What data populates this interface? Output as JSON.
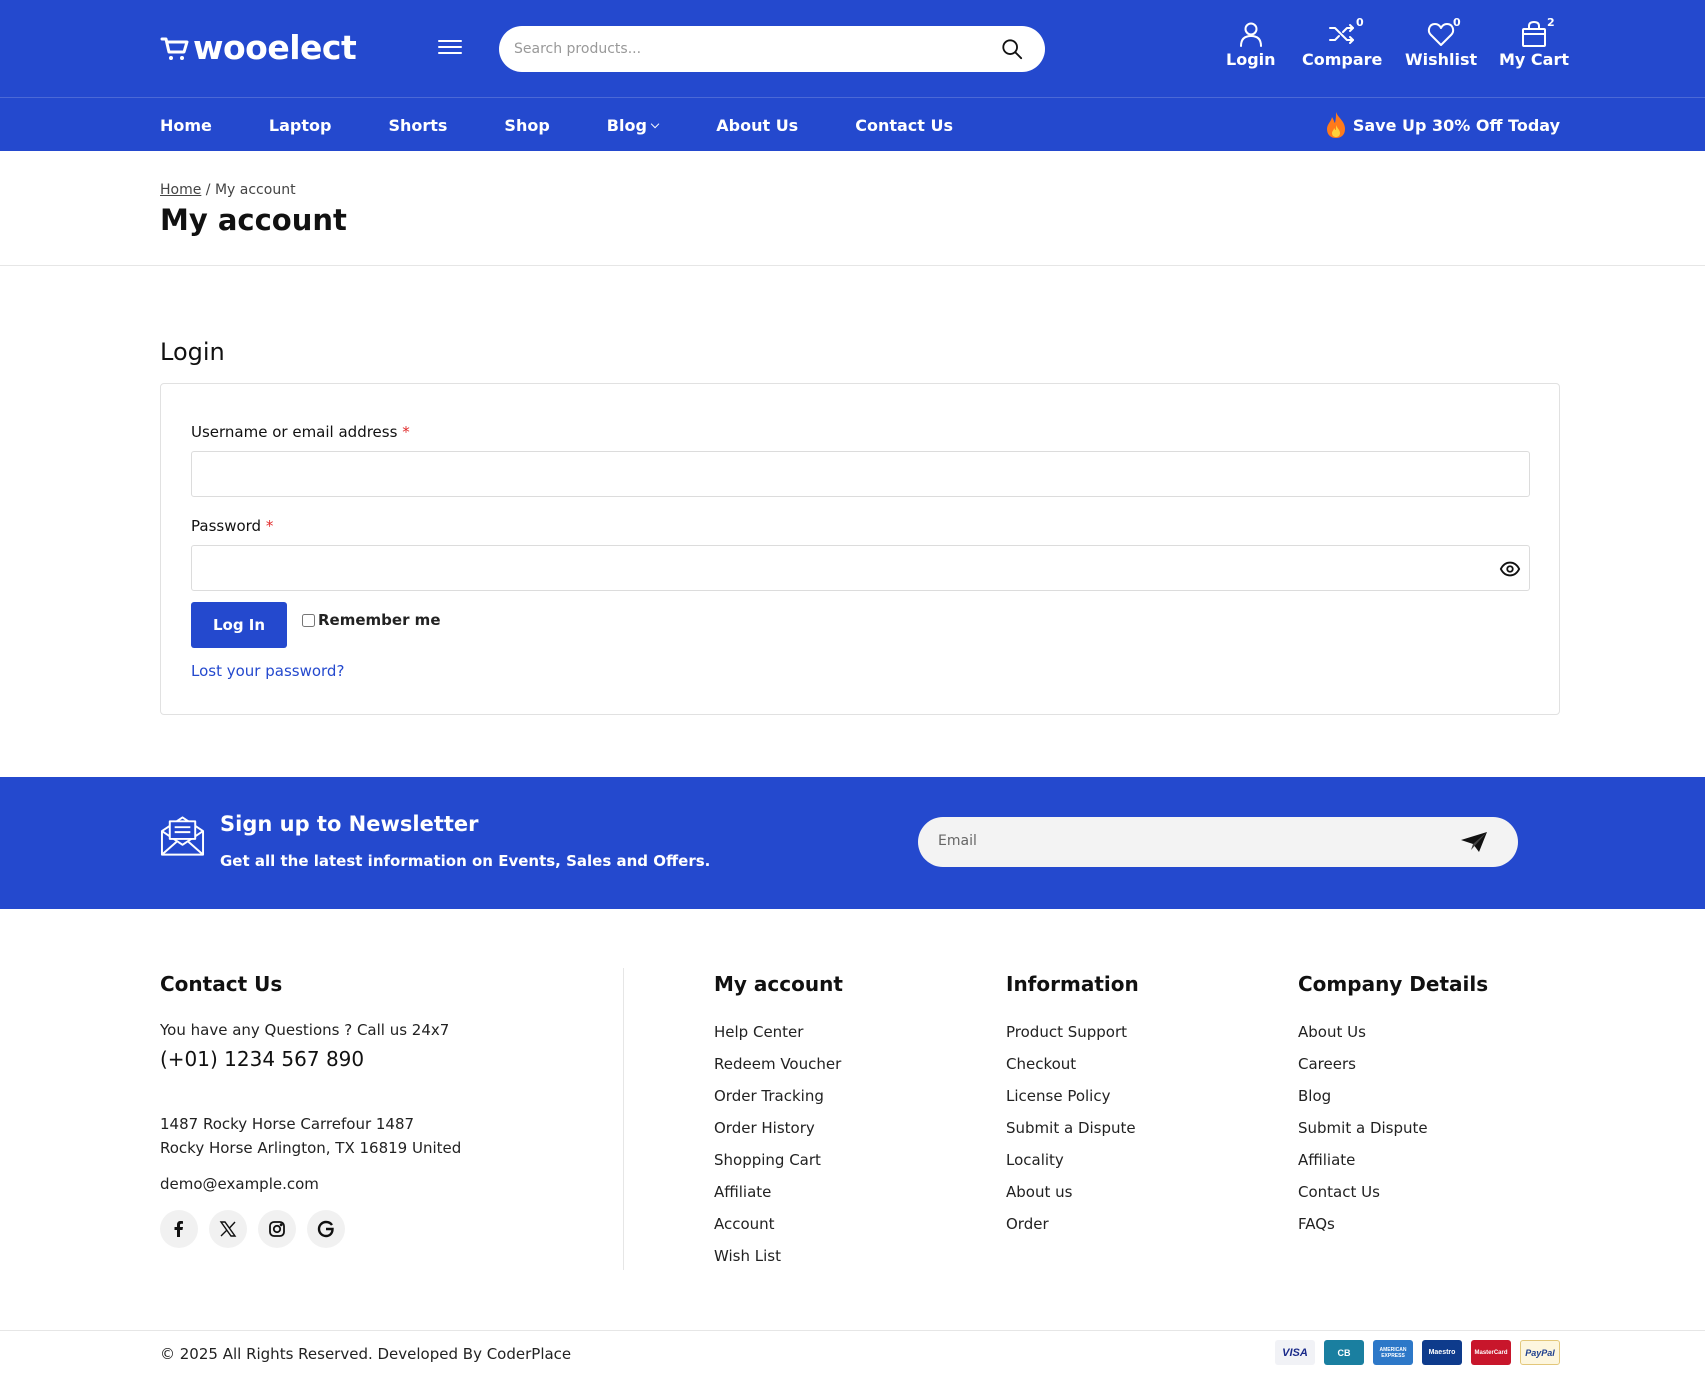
{
  "header": {
    "logo": "wooelect",
    "search": {
      "placeholder": "Search products..."
    },
    "actions": {
      "login": "Login",
      "compare": "Compare",
      "compare_count": "0",
      "wishlist": "Wishlist",
      "wishlist_count": "0",
      "cart": "My Cart",
      "cart_count": "2"
    }
  },
  "nav": {
    "items": [
      "Home",
      "Laptop",
      "Shorts",
      "Shop",
      "Blog",
      "About Us",
      "Contact Us"
    ],
    "promo": "Save Up 30% Off Today"
  },
  "breadcrumb": {
    "home": "Home",
    "separator": "/",
    "current": "My account"
  },
  "page_title": "My account",
  "login": {
    "heading": "Login",
    "username_label": "Username or email address",
    "password_label": "Password",
    "required_mark": "*",
    "username_value": "",
    "password_value": "",
    "submit": "Log In",
    "remember": "Remember me",
    "lost_password": "Lost your password?"
  },
  "newsletter": {
    "title": "Sign up to Newsletter",
    "subtitle": "Get all the latest information on Events, Sales and Offers.",
    "email_placeholder": "Email"
  },
  "footer": {
    "contact": {
      "heading": "Contact Us",
      "question": "You have any Questions ? Call us 24x7",
      "phone": "(+01) 1234 567 890",
      "address_line1": "1487 Rocky Horse Carrefour 1487",
      "address_line2": "Rocky Horse Arlington, TX 16819 United",
      "email": "demo@example.com",
      "socials": [
        "facebook-icon",
        "x-icon",
        "instagram-icon",
        "google-icon"
      ]
    },
    "columns": [
      {
        "heading": "My account",
        "links": [
          "Help Center",
          "Redeem Voucher",
          "Order Tracking",
          "Order History",
          "Shopping Cart",
          "Affiliate",
          "Account",
          "Wish List"
        ]
      },
      {
        "heading": "Information",
        "links": [
          "Product Support",
          "Checkout",
          "License Policy",
          "Submit a Dispute",
          "Locality",
          "About us",
          "Order"
        ]
      },
      {
        "heading": "Company Details",
        "links": [
          "About Us",
          "Careers",
          "Blog",
          "Submit a Dispute",
          "Affiliate",
          "Contact Us",
          "FAQs"
        ]
      }
    ],
    "copyright": "© 2025 All Rights Reserved. Developed By CoderPlace",
    "payments": [
      "VISA",
      "CB",
      "AMERICAN EXPRESS",
      "Maestro",
      "MasterCard",
      "PayPal"
    ]
  },
  "colors": {
    "brand": "#2449ce",
    "required": "#e12b2b"
  }
}
